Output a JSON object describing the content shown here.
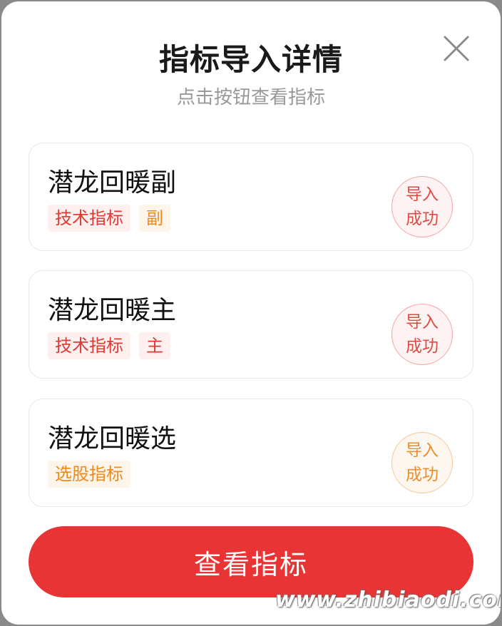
{
  "dialog": {
    "title": "指标导入详情",
    "subtitle": "点击按钮查看指标",
    "close_icon": "close-icon"
  },
  "items": [
    {
      "name": "潜龙回暖副",
      "tags": [
        "技术指标",
        "副"
      ],
      "status_line1": "导入",
      "status_line2": "成功"
    },
    {
      "name": "潜龙回暖主",
      "tags": [
        "技术指标",
        "主"
      ],
      "status_line1": "导入",
      "status_line2": "成功"
    },
    {
      "name": "潜龙回暖选",
      "tags": [
        "选股指标"
      ],
      "status_line1": "导入",
      "status_line2": "成功"
    }
  ],
  "cta_label": "查看指标",
  "watermark": "www.zhibiaodi.com",
  "colors": {
    "accent_red": "#e83434",
    "tag_red": "#e03a36",
    "tag_orange": "#ef8a1f"
  }
}
